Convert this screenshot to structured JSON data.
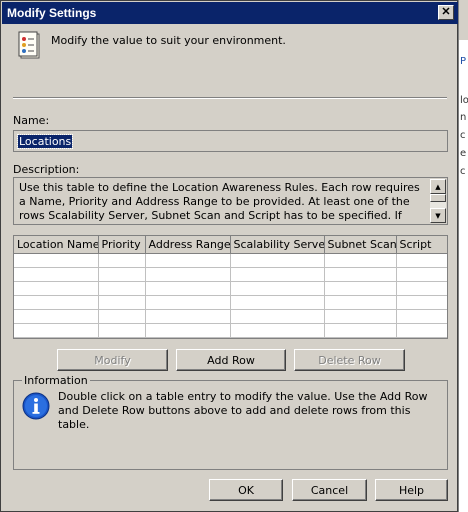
{
  "window": {
    "title": "Modify Settings",
    "close_glyph": "✕",
    "header_text": "Modify the value to suit your environment."
  },
  "name": {
    "label": "Name:",
    "value": "Locations"
  },
  "description": {
    "label": "Description:",
    "text": "Use this table to define the Location Awareness Rules. Each row requires a Name, Priority and Address Range to be provided. At least one of the rows Scalability Server, Subnet Scan and Script has to be specified. If more than one of these rows"
  },
  "table": {
    "columns": [
      "Location Name",
      "Priority",
      "Address Range",
      "Scalability Server",
      "Subnet Scan",
      "Script"
    ],
    "rows": []
  },
  "row_buttons": {
    "modify": "Modify",
    "add_row": "Add Row",
    "delete_row": "Delete Row"
  },
  "information": {
    "legend": "Information",
    "text": "Double click on a table entry to modify the value. Use the Add Row and Delete Row buttons above to add and delete rows from this table.",
    "icon": "info-icon"
  },
  "footer": {
    "ok": "OK",
    "cancel": "Cancel",
    "help": "Help"
  },
  "colors": {
    "titlebar": "#0a246a",
    "dialog_bg": "#d4d0c8",
    "selection": "#0a246a"
  }
}
